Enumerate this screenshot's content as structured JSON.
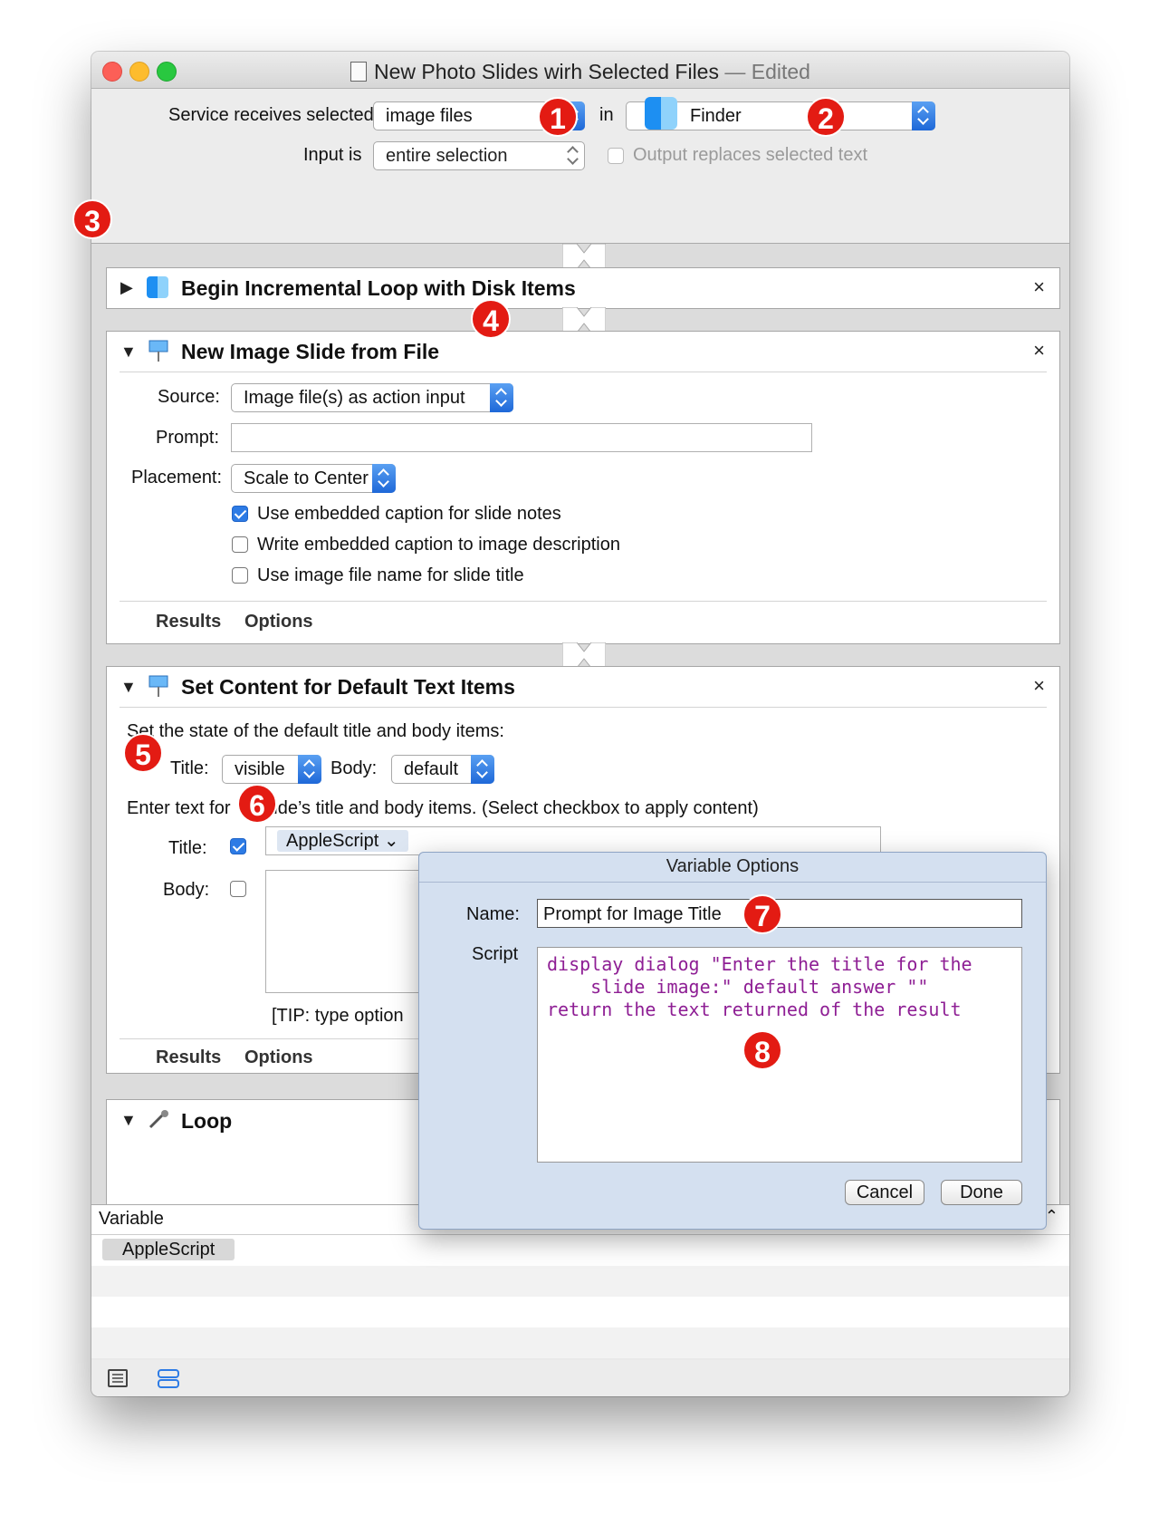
{
  "window": {
    "title": "New Photo Slides wirh Selected Files",
    "edited": "— Edited"
  },
  "header": {
    "service_label": "Service receives selected",
    "service_value": "image files",
    "in_label": "in",
    "app_value": "Finder",
    "input_label": "Input is",
    "input_value": "entire selection",
    "output_replaces": "Output replaces selected text"
  },
  "actions": [
    {
      "title": "Begin Incremental Loop with Disk Items"
    },
    {
      "title": "New Image Slide from File",
      "source_label": "Source:",
      "source_value": "Image file(s) as action input",
      "prompt_label": "Prompt:",
      "placement_label": "Placement:",
      "placement_value": "Scale to Center",
      "checks": [
        {
          "label": "Use embedded caption for slide notes",
          "checked": true
        },
        {
          "label": "Write embedded caption to image description",
          "checked": false
        },
        {
          "label": "Use image file name for slide title",
          "checked": false
        }
      ],
      "tabs": [
        "Results",
        "Options"
      ]
    },
    {
      "title": "Set Content for Default Text Items",
      "state_text": "Set the state of the default title and body items:",
      "title_label": "Title:",
      "title_value": "visible",
      "body_label": "Body:",
      "body_value": "default",
      "enter_text": "Enter text for      slide’s title and body items. (Select checkbox to apply content)",
      "title_field_label": "Title:",
      "title_token": "AppleScript ⌄",
      "body_field_label": "Body:",
      "tip": "[TIP: type option",
      "tabs": [
        "Results",
        "Options"
      ]
    },
    {
      "title": "Loop"
    }
  ],
  "variables": {
    "header": "Variable",
    "items": [
      "AppleScript"
    ]
  },
  "dialog": {
    "title": "Variable Options",
    "name_label": "Name:",
    "name_value": "Prompt for Image Title",
    "script_label": "Script",
    "script_lines": [
      "display dialog \"Enter the title for the",
      "    slide image:\" default answer \"\"",
      "return the text returned of the result"
    ],
    "cancel": "Cancel",
    "done": "Done"
  },
  "badges": [
    "1",
    "2",
    "3",
    "4",
    "5",
    "6",
    "7",
    "8"
  ],
  "colors": {
    "accent": "#2d7be5",
    "badge": "#e31b13",
    "script": "#8e1e94"
  },
  "icons": [
    "automator-file-icon",
    "finder-icon",
    "keynote-icon",
    "loop-icon",
    "list-view-icon",
    "flow-view-icon"
  ]
}
